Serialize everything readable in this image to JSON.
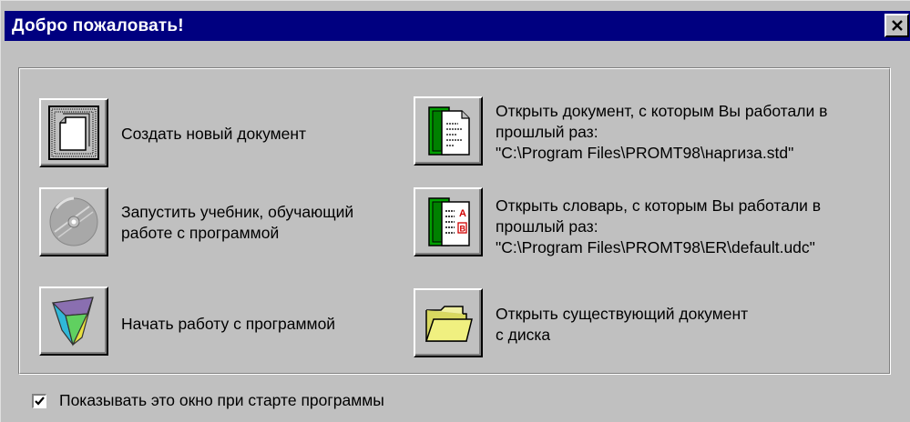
{
  "window": {
    "title": "Добро пожаловать!"
  },
  "actions": {
    "new_document": "Создать новый документ",
    "tutorial": "Запустить учебник, обучающий\nработе с программой",
    "start_program": "Начать работу с программой",
    "open_last_document": "Открыть документ, с которым Вы работали в\nпрошлый раз:\n\"C:\\Program Files\\PROMT98\\наргиза.std\"",
    "open_last_dictionary": "Открыть словарь, с которым Вы работали в\nпрошлый раз:\n\"C:\\Program Files\\PROMT98\\ER\\default.udc\"",
    "open_existing": "Открыть существующий документ\nс диска"
  },
  "checkbox": {
    "label": "Показывать это окно при старте программы",
    "checked": true
  },
  "icons": {
    "new_document": "new-document-icon",
    "tutorial": "cd-disc-icon",
    "start_program": "promt-logo-icon",
    "open_last_document": "recent-document-icon",
    "open_last_dictionary": "dictionary-icon",
    "open_existing": "folder-icon"
  },
  "colors": {
    "titlebar": "#000080",
    "face": "#c0c0c0",
    "accent_green": "#00a000",
    "folder_yellow": "#e8e870"
  }
}
